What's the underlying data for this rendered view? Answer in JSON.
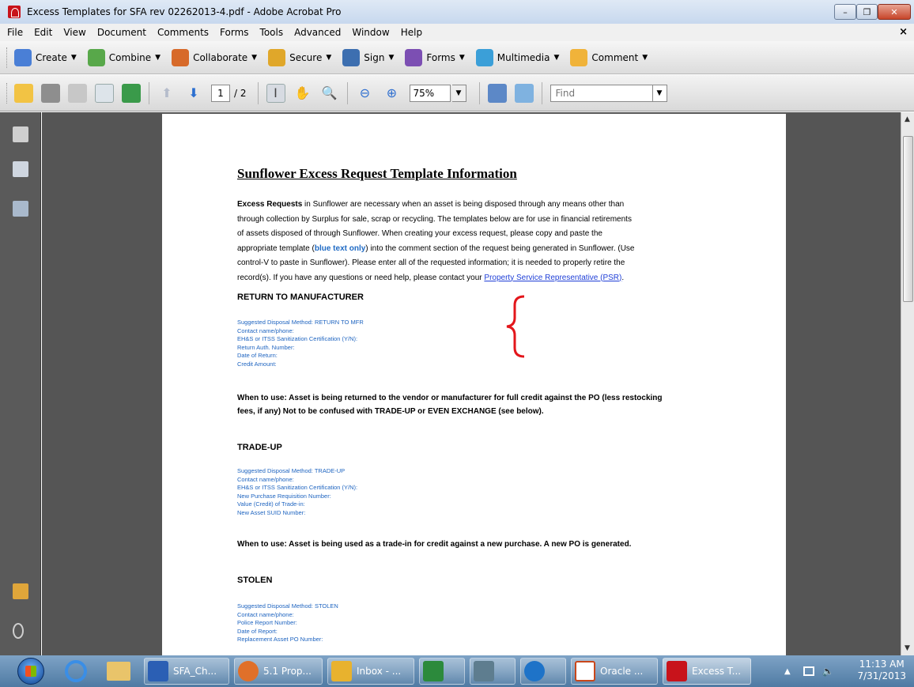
{
  "window": {
    "title": "Excess Templates for SFA rev 02262013-4.pdf - Adobe Acrobat Pro",
    "min": "–",
    "max": "❐",
    "close": "✕"
  },
  "menu": [
    "File",
    "Edit",
    "View",
    "Document",
    "Comments",
    "Forms",
    "Tools",
    "Advanced",
    "Window",
    "Help"
  ],
  "menu_close": "×",
  "tasks": [
    {
      "label": "Create",
      "icon": "create-icon",
      "color": "#4a7fd6"
    },
    {
      "label": "Combine",
      "icon": "combine-icon",
      "color": "#58a84a"
    },
    {
      "label": "Collaborate",
      "icon": "collaborate-icon",
      "color": "#d76a2a"
    },
    {
      "label": "Secure",
      "icon": "lock-icon",
      "color": "#e0a72a"
    },
    {
      "label": "Sign",
      "icon": "pen-icon",
      "color": "#3d6fb0"
    },
    {
      "label": "Forms",
      "icon": "forms-icon",
      "color": "#7c4fb3"
    },
    {
      "label": "Multimedia",
      "icon": "multimedia-icon",
      "color": "#3b9fd8"
    },
    {
      "label": "Comment",
      "icon": "comment-icon",
      "color": "#f0b33a"
    }
  ],
  "toolbar": {
    "page_current": "1",
    "page_total": "/ 2",
    "zoom": "75%",
    "find_placeholder": "Find"
  },
  "document": {
    "title": "Sunflower Excess Request Template Information",
    "intro": {
      "l1_bold": "Excess Requests",
      "l1_rest": " in Sunflower are necessary when an asset is being disposed through any means other than",
      "l2": "through collection by Surplus for sale, scrap or recycling.  The templates below are for use in financial retirements",
      "l3": "of assets disposed of through Sunflower.  When creating your excess request, please copy and paste the",
      "l4_a": "appropriate template (",
      "l4_blue": "blue text only",
      "l4_b": ") into the comment section of the request being generated in Sunflower.  (Use",
      "l5": "control-V to paste in Sunflower).  Please enter all of the requested information; it is needed to properly retire the",
      "l6_a": "record(s).  If you have any questions or need help, please contact your  ",
      "l6_link": "Property Service Representative (PSR)",
      "l6_b": "."
    },
    "sections": [
      {
        "heading": "RETURN TO MANUFACTURER",
        "lines": [
          "Suggested Disposal Method: RETURN TO MFR",
          "Contact name/phone:",
          "EH&S or ITSS Sanitization Certification (Y/N):",
          "Return Auth. Number:",
          "Date of Return:",
          "Credit Amount:"
        ],
        "when": [
          "When to use: Asset is being returned to the vendor or manufacturer for full credit against the PO (less restocking",
          "fees, if any) Not to be confused with TRADE-UP or EVEN EXCHANGE (see below)."
        ]
      },
      {
        "heading": "TRADE-UP",
        "lines": [
          "Suggested Disposal Method:  TRADE-UP",
          "Contact name/phone:",
          "EH&S or ITSS Sanitization Certification (Y/N):",
          "New Purchase Requisition Number:",
          "Value (Credit) of Trade-in:",
          "New Asset SUID Number:"
        ],
        "when": [
          "When to use: Asset is being used as a trade-in for credit against a new purchase. A new PO is generated."
        ]
      },
      {
        "heading": "STOLEN",
        "lines": [
          "Suggested Disposal Method: STOLEN",
          "Contact name/phone:",
          "Police Report Number:",
          "Date of Report:",
          "Replacement Asset PO Number:"
        ],
        "when": []
      }
    ]
  },
  "taskbar": {
    "items": [
      {
        "label": "SFA_Ch...",
        "color": "#2b5fb4"
      },
      {
        "label": "5.1 Prop...",
        "color": "#e0702a"
      },
      {
        "label": "Inbox - ...",
        "color": "#e8b22e"
      },
      {
        "label": "",
        "color": "#2c8a3c"
      },
      {
        "label": "",
        "color": "#5e7d8f"
      },
      {
        "label": "",
        "color": "#1e73c8"
      },
      {
        "label": "Oracle ...",
        "color": "#c9471b"
      },
      {
        "label": "Excess T...",
        "color": "#c8131b"
      }
    ],
    "time": "11:13 AM",
    "date": "7/31/2013"
  }
}
